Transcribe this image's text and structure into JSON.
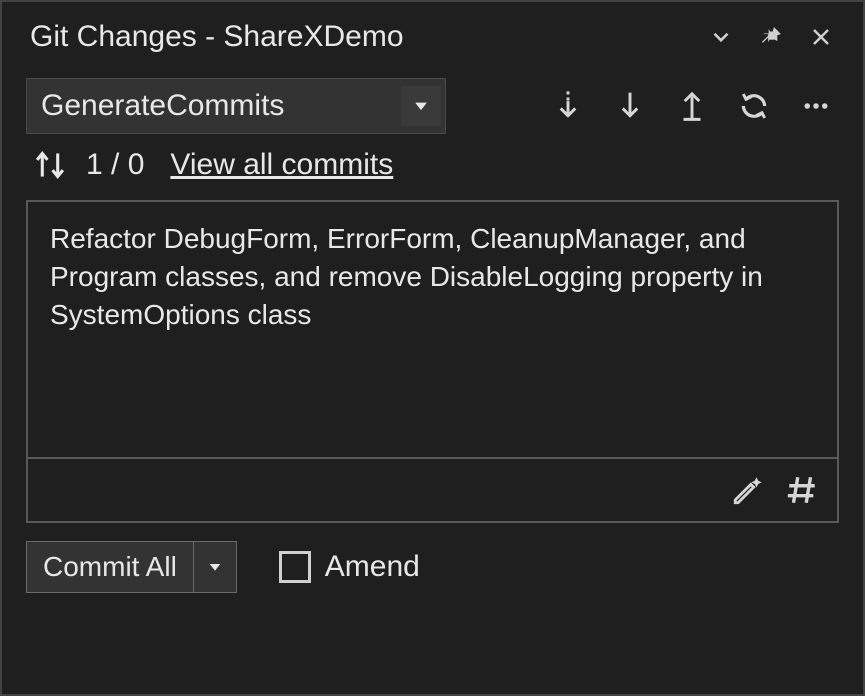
{
  "title": "Git Changes - ShareXDemo",
  "branch": {
    "name": "GenerateCommits"
  },
  "stats": {
    "outgoing": 1,
    "incoming": 0,
    "link": "View all commits"
  },
  "commit": {
    "message": "Refactor DebugForm, ErrorForm, CleanupManager, and Program classes, and remove DisableLogging property in SystemOptions class",
    "button_label": "Commit All",
    "amend_label": "Amend",
    "amend_checked": false
  },
  "icons": {
    "collapse": "collapse-icon",
    "pin": "pin-icon",
    "close": "close-icon",
    "fetch": "fetch-icon",
    "pull": "pull-icon",
    "push": "push-icon",
    "sync": "sync-icon",
    "more": "more-icon",
    "ai": "ai-sparkle-pen-icon",
    "hash": "hash-icon"
  }
}
